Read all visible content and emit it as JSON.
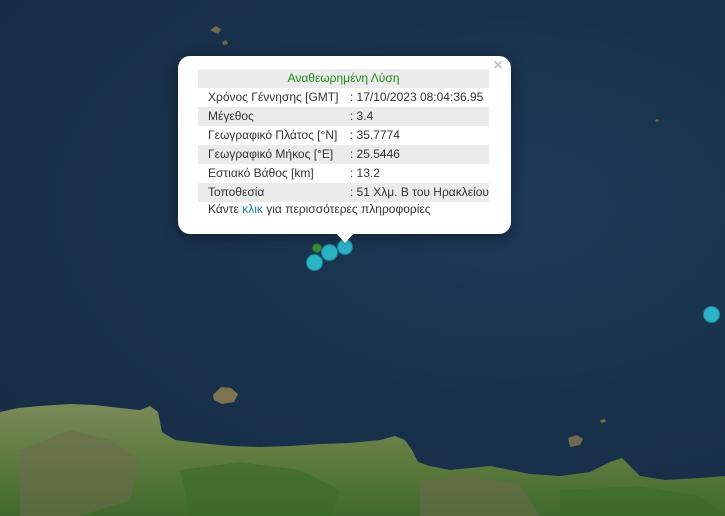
{
  "popup": {
    "title": "Αναθεωρημένη Λύση",
    "rows": [
      {
        "label": "Χρόνος Γέννησης [GMT]",
        "value": ": 17/10/2023 08:04:36.95"
      },
      {
        "label": "Μέγεθος",
        "value": ": 3.4"
      },
      {
        "label": "Γεωγραφικό Πλάτος [°N]",
        "value": ": 35.7774"
      },
      {
        "label": "Γεωγραφικό Μήκος [°E]",
        "value": ": 25.5446"
      },
      {
        "label": "Εστιακό Βάθος [km]",
        "value": ": 13.2"
      },
      {
        "label": "Τοποθεσία",
        "value": ": 51 Χλμ. Β του Ηρακλείου"
      }
    ],
    "more_prefix": "Κάντε",
    "more_link": "κλικ",
    "more_suffix": "για περισσότερες πληροφορίες",
    "close": "×"
  },
  "map": {
    "sea_color": "#1b3450",
    "land_color": "#5a7a3e",
    "marker_color": "#2cb3c6",
    "small_marker_color": "#3d8a3e"
  }
}
